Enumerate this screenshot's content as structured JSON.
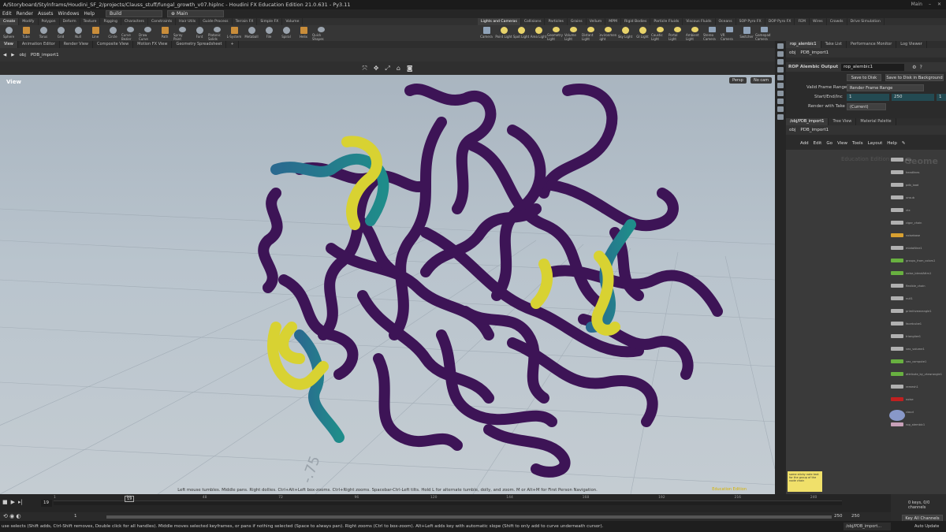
{
  "window": {
    "title": "A/Storyboard/Stylnframs/Houdini_SF_2/projects/Clauss_stuff/fungal_growth_v07.hiplnc - Houdini FX Education Edition 21.0.631 - Py3.11",
    "main_label": "Main"
  },
  "menu": {
    "items": [
      "Edit",
      "Render",
      "Assets",
      "Windows",
      "Help"
    ],
    "build_dropdown": "Build",
    "desktop_dropdown": "Main"
  },
  "shelf_tabs_left": [
    "Create",
    "Modify",
    "Polygon",
    "Deform",
    "Texture",
    "Rigging",
    "Characters",
    "Constraints",
    "Hair Utils",
    "Guide Process",
    "Terrain FX",
    "Simple FX",
    "Volume"
  ],
  "shelf_tabs_right": [
    "Lights and Cameras",
    "Collisions",
    "Particles",
    "Grains",
    "Vellum",
    "MPM",
    "Rigid Bodies",
    "Particle Fluids",
    "Viscous Fluids",
    "Oceans",
    "SOP Pyro FX",
    "DOP Pyro FX",
    "FEM",
    "Wires",
    "Crowds",
    "Drive Simulation"
  ],
  "shelf_tools_left": [
    "Sphere",
    "Tube",
    "Torus",
    "Grid",
    "Null",
    "Line",
    "Circle",
    "Curve Bezier",
    "Draw Curve",
    "Path",
    "Spray Paint",
    "Font",
    "Platonic Solids",
    "L-System",
    "Metaball",
    "File",
    "Spiral",
    "Helix",
    "Quick Shapes"
  ],
  "shelf_tools_right": [
    "Camera",
    "Point Light",
    "Spot Light",
    "Area Light",
    "Geometry Light",
    "Volume Light",
    "Distant Light",
    "Environment Light",
    "Sky Light",
    "GI Light",
    "Caustic Light",
    "Portal Light",
    "Ambient Light",
    "Stereo Camera",
    "VR Camera",
    "Switcher",
    "Gamepad Camera"
  ],
  "viewer_tabs": [
    "View",
    "Animation Editor",
    "Render View",
    "Composite View",
    "Motion FX View",
    "Geometry Spreadsheet"
  ],
  "viewer_path": [
    "obj",
    "PDB_import1"
  ],
  "viewport": {
    "label": "View",
    "persp": "Persp",
    "camera": "No cam",
    "grid_label": "-.75",
    "hint": "Left mouse tumbles. Middle pans. Right dollies. Ctrl+Alt+Left box-zooms. Ctrl+Right zooms. Spacebar-Ctrl-Left tilts. Hold L for alternate tumble, dolly, and zoom. M or Alt+M for First Person Navigation.",
    "badge": "Education Edition"
  },
  "params_pane": {
    "tabs": [
      "rop_alembic1",
      "Take List",
      "Performance Monitor",
      "Log Viewer"
    ],
    "path": [
      "obj",
      "PDB_import1"
    ],
    "node_type": "ROP Alembic Output",
    "node_name": "rop_alembic1",
    "save_to_disk": "Save to Disk",
    "save_background": "Save to Disk in Background",
    "valid_frame_range_label": "Valid Frame Range",
    "valid_frame_range_value": "Render Frame Range",
    "start_end_label": "Start/End/Inc",
    "start": "1",
    "end": "250",
    "inc": "1",
    "render_take_label": "Render with Take",
    "render_take_value": "(Current)"
  },
  "network_pane": {
    "tabs": [
      "/obj/PDB_import1",
      "Tree View",
      "Material Palette"
    ],
    "path": [
      "obj",
      "PDB_import1"
    ],
    "menu": [
      "Add",
      "Edit",
      "Go",
      "View",
      "Tools",
      "Layout",
      "Help"
    ],
    "watermark": "Education Edition",
    "title": "Geome",
    "nodes": [
      "font",
      "headlines",
      "pdb_load",
      "unsub",
      "vtx",
      "cigar_chain",
      "noisebase",
      "mixtoNine1",
      "groups_from_colors1",
      "noise_blendAttrs1",
      "flexible_chain",
      "null1",
      "primitivewrangle1",
      "facetcube1",
      "trianglize1",
      "vex_volume1",
      "vex_compute1",
      "attribute_by_vtxwrangle1",
      "remesh1",
      "noise",
      "cloud",
      "rop_alembic1"
    ],
    "sticky_note": "some sticky note text for the group of the node chain"
  },
  "timeline": {
    "current_frame": "19",
    "frame_marker": "19",
    "ticks": [
      "1",
      "24",
      "48",
      "72",
      "96",
      "120",
      "144",
      "168",
      "192",
      "216",
      "240"
    ],
    "start": "1",
    "range_start": "1",
    "range_end": "250",
    "end": "250"
  },
  "keys": {
    "count": "0 keys, 0/0 channels",
    "all_channels": "Key All Channels"
  },
  "status": {
    "text": "use selects (Shift adds, Ctrl-Shift removes, Double click for all handles). Middle moves selected keyframes, or pans if nothing selected (Space to always pan). Right zooms (Ctrl to box-zoom). Alt+Left adds key with automatic slope (Shift to only add to curve underneath cursor).",
    "path": "/obj/PDB_import...",
    "update": "Auto Update"
  },
  "colors": {
    "tube_purple": "#3d1456",
    "tube_teal": "#1f8c8a",
    "tube_yellow": "#d8d232",
    "sky_top": "#a9b5c0",
    "node_orange": "#d8a030",
    "node_green": "#68b040",
    "node_red": "#c02020"
  }
}
